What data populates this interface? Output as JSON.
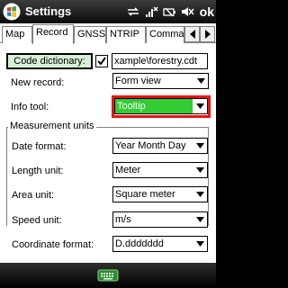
{
  "window": {
    "title": "Settings",
    "ok_label": "ok"
  },
  "tabs": [
    {
      "label": "Map",
      "active": false
    },
    {
      "label": "Record",
      "active": true
    },
    {
      "label": "GNSS",
      "active": false
    },
    {
      "label": "NTRIP",
      "active": false
    },
    {
      "label": "Commar",
      "active": false
    }
  ],
  "record": {
    "code_dictionary_label": "Code dictionary:",
    "code_dictionary_checked": true,
    "code_dictionary_path": "xample\\forestry.cdt",
    "new_record_label": "New record:",
    "new_record_value": "Form view",
    "info_tool_label": "Info tool:",
    "info_tool_value": "Tooltip"
  },
  "measurement_units": {
    "group_title": "Measurement units",
    "date_format_label": "Date format:",
    "date_format_value": "Year Month Day",
    "length_unit_label": "Length unit:",
    "length_unit_value": "Meter",
    "area_unit_label": "Area unit:",
    "area_unit_value": "Square meter",
    "speed_unit_label": "Speed unit:",
    "speed_unit_value": "m/s",
    "coordinate_format_label": "Coordinate format:",
    "coordinate_format_value": "D.ddddddd"
  },
  "colors": {
    "titlebar": "#1a1a1a",
    "highlight_fill": "#33cc33",
    "highlight_border": "#ee1111",
    "code_button_fill": "#d8f0d8"
  },
  "icons": [
    "windows-logo-icon",
    "connectivity-icon",
    "signal-icon",
    "battery-icon",
    "volume-muted-icon",
    "keyboard-icon"
  ]
}
